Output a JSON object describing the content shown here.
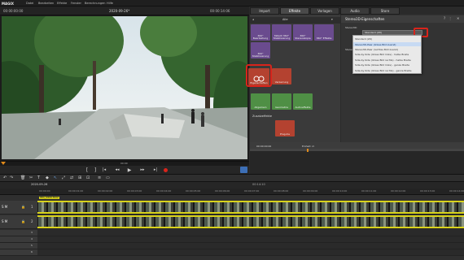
{
  "app": {
    "logo": "MAGIX"
  },
  "menu": {
    "items": [
      "Datei",
      "Bearbeiten",
      "Effekte",
      "Fenster",
      "Berechnungen",
      "Hilfe"
    ]
  },
  "player": {
    "timecode_left": "00:00:00:00",
    "clip_title": "2020-09-26*",
    "timecode_right": "00:00:14:06",
    "position_label": "00:00"
  },
  "tabs": {
    "import": "Import",
    "effects": "Effekte",
    "templates": "Vorlagen",
    "audio": "Audio",
    "store": "Store"
  },
  "effects_panel": {
    "header": "Alle",
    "row1": [
      {
        "label": "360° Bearbeitung",
        "color": "#6a4b8e"
      },
      {
        "label": "MAGIX 360° Stabilisierung",
        "color": "#6a4b8e"
      },
      {
        "label": "360° Stereoskopie",
        "color": "#6a4b8e"
      },
      {
        "label": "360° Effekte",
        "color": "#6a4b8e"
      }
    ],
    "row2": [
      {
        "label": "360° Stabilisierung",
        "color": "#6a4b8e"
      }
    ],
    "row3": [
      {
        "label": "Eigenschaften",
        "color": "#b44230"
      },
      {
        "label": "Verzerrung",
        "color": "#b44230"
      }
    ],
    "row4": [
      {
        "label": "Allgemein",
        "color": "#4f8f45"
      },
      {
        "label": "Geometrie",
        "color": "#4f8f45"
      },
      {
        "label": "Audio­effekte",
        "color": "#4f8f45"
      }
    ],
    "section_label": "Zusatzeffekte",
    "row5": [
      {
        "label": "Plug-Ins",
        "color": "#b44230"
      }
    ]
  },
  "properties": {
    "title": "Stereo3D-Eigenschaften",
    "label1": "Stereo3D:",
    "label2": "Stereo",
    "options": [
      "Standard (2D)",
      "Stereo3D-Paar (linkes Bild zuerst)",
      "Stereo3D-Paar (rechtes Bild zuerst)",
      "Side-by-Side (linkes Bild links) - halbe Breite",
      "Side-by-Side (linkes Bild rechts) - halbe Breite",
      "Side-by-Side (linkes Bild links) - ganze Breite",
      "Side-by-Side (linkes Bild rechts) - ganze Breite"
    ],
    "selected_index": 1,
    "accent": "#d9241b"
  },
  "status": {
    "time": "00:00:00:00",
    "extra": "Einheit: m"
  },
  "timeline": {
    "title": "2020-09-26",
    "mid_label": "00:14:10",
    "clip_name": "IMG_0806.MOV",
    "ruler": [
      "00:00:00",
      "00:00:01:00",
      "00:00:02:00",
      "00:00:03:00",
      "00:00:04:00",
      "00:00:05:00",
      "00:00:06:00",
      "00:00:07:00",
      "00:00:08:00",
      "00:00:09:00",
      "00:00:10:00",
      "00:00:11:00",
      "00:00:12:00",
      "00:00:13:00",
      "00:00:14:00"
    ],
    "track1": "S M",
    "track2": "S M",
    "track_numbers": [
      "1",
      "2",
      "3",
      "4",
      "5",
      "6"
    ]
  }
}
